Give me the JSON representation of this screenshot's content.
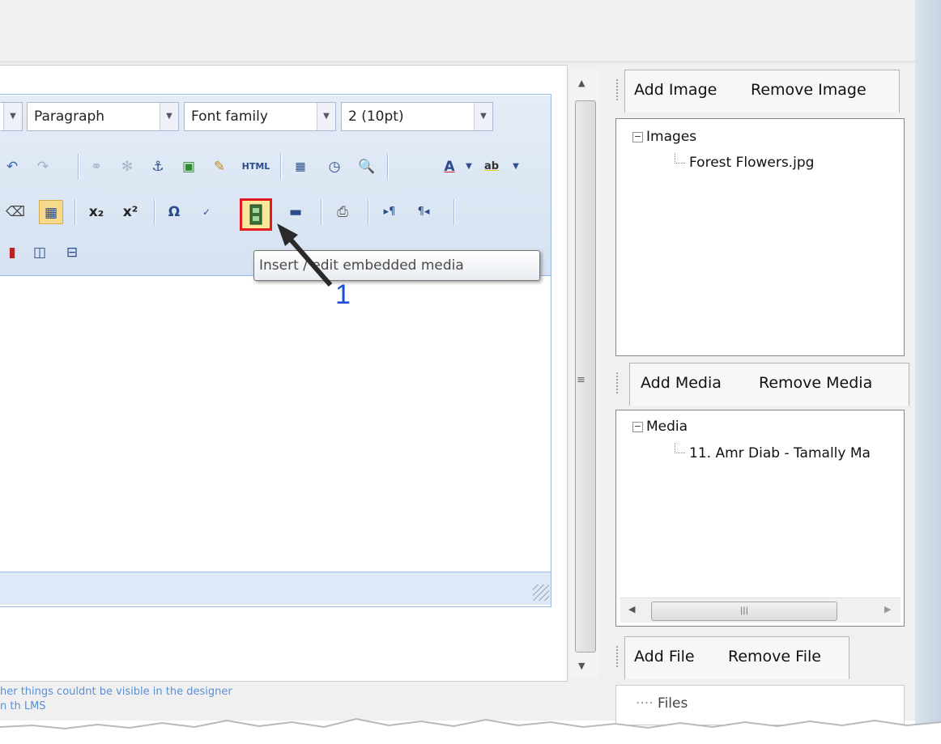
{
  "toolbar": {
    "format_select": "Paragraph",
    "font_family_select": "Font family",
    "font_size_select": "2 (10pt)",
    "tooltip": "Insert / edit embedded media",
    "html_button": "HTML"
  },
  "annotation": {
    "step": "1"
  },
  "images_panel": {
    "add_label": "Add Image",
    "remove_label": "Remove Image",
    "root": "Images",
    "items": [
      "Forest Flowers.jpg"
    ]
  },
  "media_panel": {
    "add_label": "Add Media",
    "remove_label": "Remove Media",
    "root": "Media",
    "items": [
      "11. Amr Diab - Tamally Ma"
    ]
  },
  "files_panel": {
    "add_label": "Add File",
    "remove_label": "Remove File",
    "root": "Files"
  },
  "bottom_note": {
    "line1": "her things couldnt be visible in the designer",
    "line2": "n th LMS"
  },
  "colors": {
    "accent_border": "#99bbe8",
    "highlight_red": "#e31b23",
    "annotation_blue": "#1a4fd6"
  }
}
